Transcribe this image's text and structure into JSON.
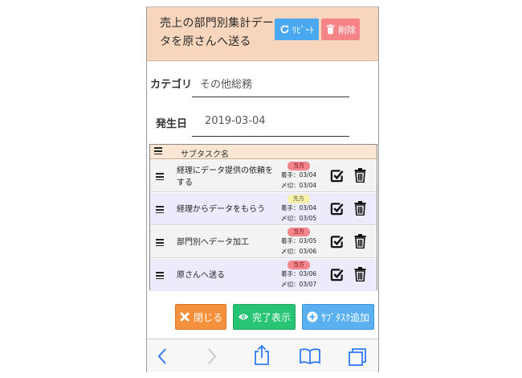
{
  "header": {
    "title": "売上の部門別集計データを原さんへ送る",
    "repeat_label": "ﾘﾋﾟｰﾄ",
    "delete_label": "削除",
    "bg_color": "#f8d6bd"
  },
  "form": {
    "category_label": "カテゴリ",
    "category_value": "その他総務",
    "date_label": "発生日",
    "date_value": "2019-03-04"
  },
  "subtasks": {
    "header_label": "サブタスク名",
    "rows": [
      {
        "name": "経理にデータ提供の依頼をする",
        "badge": "当方",
        "start": "着手：03/04",
        "due": "〆切：03/04"
      },
      {
        "name": "経理からデータをもらう",
        "badge": "先方",
        "start": "着手：03/04",
        "due": "〆切：03/05"
      },
      {
        "name": "部門別へデータ加工",
        "badge": "当方",
        "start": "着手：03/05",
        "due": "〆切：03/06"
      },
      {
        "name": "原さんへ送る",
        "badge": "当方",
        "start": "着手：03/06",
        "due": "〆切：03/07"
      }
    ]
  },
  "buttons": {
    "close_label": "閉じる",
    "show_done_label": "完了表示",
    "add_subtask_label": "ｻﾌﾞﾀｽｸ追加"
  },
  "toolbar": {
    "icons": [
      "back-icon",
      "forward-icon",
      "share-icon",
      "bookmarks-icon",
      "tabs-icon"
    ]
  },
  "colors": {
    "accent_blue": "#4aa8f0",
    "danger": "#f58488",
    "orange": "#f5913c",
    "green": "#27c473"
  }
}
